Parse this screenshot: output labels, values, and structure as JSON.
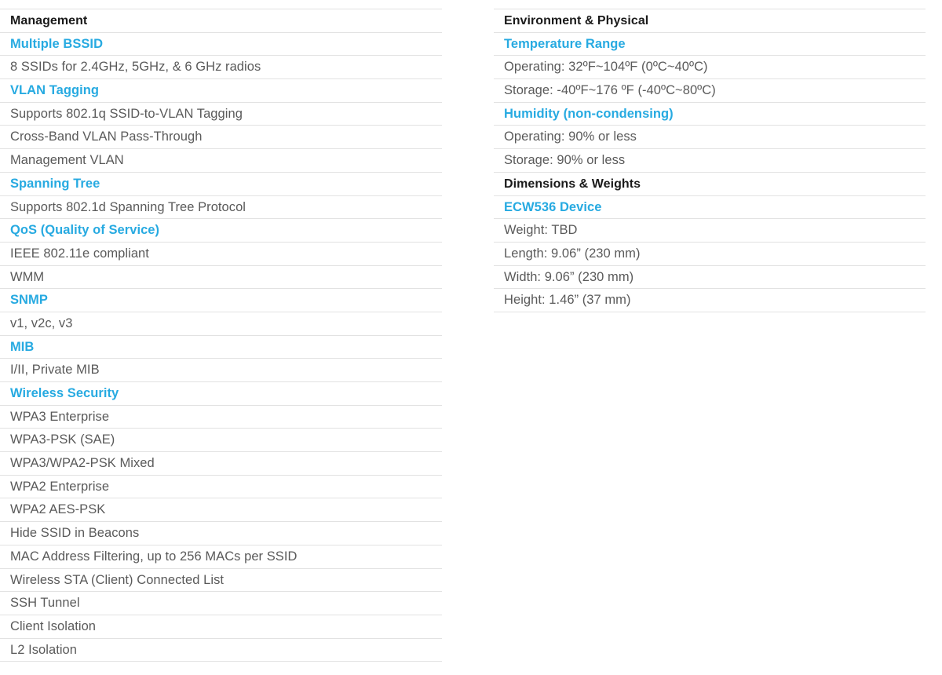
{
  "theme": {
    "accent_blue": "#27aae1",
    "section_black": "#1a1a1a",
    "body_gray": "#5a5a5a",
    "rule_gray": "#e2e2e2",
    "background": "#ffffff"
  },
  "columns": [
    {
      "id": "left",
      "rows": [
        {
          "type": "section",
          "label": "Management"
        },
        {
          "type": "subsection",
          "label": "Multiple BSSID"
        },
        {
          "type": "detail",
          "label": "8 SSIDs for 2.4GHz, 5GHz, & 6 GHz radios"
        },
        {
          "type": "subsection",
          "label": "VLAN Tagging"
        },
        {
          "type": "detail",
          "label": "Supports 802.1q SSID-to-VLAN Tagging"
        },
        {
          "type": "detail",
          "label": "Cross-Band VLAN Pass-Through"
        },
        {
          "type": "detail",
          "label": "Management VLAN"
        },
        {
          "type": "subsection",
          "label": "Spanning Tree"
        },
        {
          "type": "detail",
          "label": "Supports 802.1d Spanning Tree Protocol"
        },
        {
          "type": "subsection",
          "label": "QoS (Quality of Service)"
        },
        {
          "type": "detail",
          "label": "IEEE 802.11e compliant"
        },
        {
          "type": "detail",
          "label": "WMM"
        },
        {
          "type": "subsection",
          "label": "SNMP"
        },
        {
          "type": "detail",
          "label": "v1, v2c, v3"
        },
        {
          "type": "subsection",
          "label": "MIB"
        },
        {
          "type": "detail",
          "label": "I/II, Private MIB"
        },
        {
          "type": "subsection",
          "label": "Wireless Security"
        },
        {
          "type": "detail",
          "label": "WPA3 Enterprise"
        },
        {
          "type": "detail",
          "label": "WPA3-PSK (SAE)"
        },
        {
          "type": "detail",
          "label": "WPA3/WPA2-PSK Mixed"
        },
        {
          "type": "detail",
          "label": "WPA2 Enterprise"
        },
        {
          "type": "detail",
          "label": "WPA2 AES-PSK"
        },
        {
          "type": "detail",
          "label": "Hide SSID in Beacons"
        },
        {
          "type": "detail",
          "label": "MAC Address Filtering, up to 256 MACs per SSID"
        },
        {
          "type": "detail",
          "label": "Wireless STA (Client) Connected List"
        },
        {
          "type": "detail",
          "label": "SSH Tunnel"
        },
        {
          "type": "detail",
          "label": "Client Isolation"
        },
        {
          "type": "detail",
          "label": "L2 Isolation"
        }
      ]
    },
    {
      "id": "right",
      "rows": [
        {
          "type": "section",
          "label": "Environment & Physical"
        },
        {
          "type": "subsection",
          "label": "Temperature Range"
        },
        {
          "type": "detail",
          "label": "Operating: 32ºF~104ºF (0ºC~40ºC)"
        },
        {
          "type": "detail",
          "label": "Storage: -40ºF~176 ºF (-40ºC~80ºC)"
        },
        {
          "type": "subsection",
          "label": "Humidity (non-condensing)"
        },
        {
          "type": "detail",
          "label": "Operating: 90% or less"
        },
        {
          "type": "detail",
          "label": "Storage: 90% or less"
        },
        {
          "type": "section",
          "label": "Dimensions & Weights"
        },
        {
          "type": "subsection",
          "label": "ECW536 Device"
        },
        {
          "type": "detail",
          "label": "Weight: TBD"
        },
        {
          "type": "detail",
          "label": "Length: 9.06” (230 mm)"
        },
        {
          "type": "detail",
          "label": "Width:  9.06” (230 mm)"
        },
        {
          "type": "detail",
          "label": "Height:  1.46” (37 mm)"
        }
      ]
    }
  ]
}
